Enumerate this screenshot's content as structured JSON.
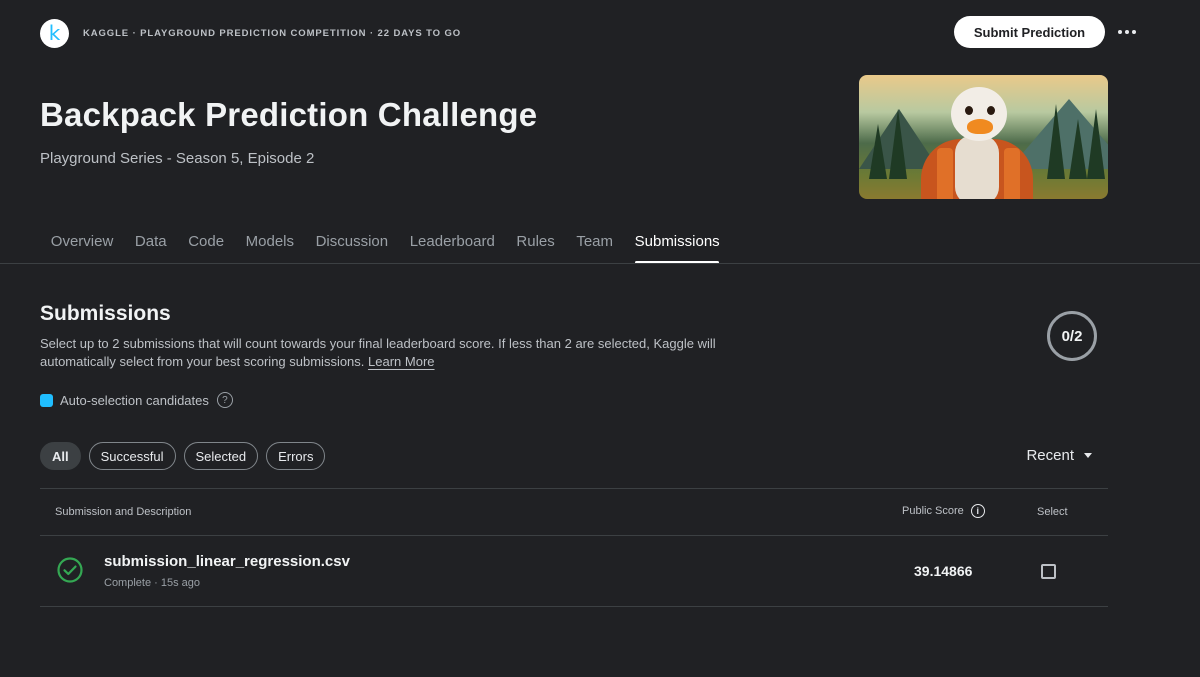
{
  "header": {
    "logo_letter": "k",
    "breadcrumb": "KAGGLE · PLAYGROUND PREDICTION COMPETITION · 22 DAYS TO GO",
    "submit_label": "Submit Prediction",
    "more_icon": "more-horizontal-icon"
  },
  "competition": {
    "title": "Backpack Prediction Challenge",
    "subtitle": "Playground Series - Season 5, Episode 2",
    "hero_image_alt": "Duck wearing a backpack in a mountain forest"
  },
  "tabs": [
    {
      "label": "Overview",
      "active": false
    },
    {
      "label": "Data",
      "active": false
    },
    {
      "label": "Code",
      "active": false
    },
    {
      "label": "Models",
      "active": false
    },
    {
      "label": "Discussion",
      "active": false
    },
    {
      "label": "Leaderboard",
      "active": false
    },
    {
      "label": "Rules",
      "active": false
    },
    {
      "label": "Team",
      "active": false
    },
    {
      "label": "Submissions",
      "active": true
    }
  ],
  "submissions": {
    "title": "Submissions",
    "description": "Select up to 2 submissions that will count towards your final leaderboard score. If less than 2 are selected, Kaggle will automatically select from your best scoring submissions.",
    "learn_more": "Learn More",
    "selected_counter": "0/2",
    "legend_label": "Auto-selection candidates",
    "legend_color": "#20beff",
    "help_icon": "?",
    "filters": [
      {
        "label": "All",
        "active": true
      },
      {
        "label": "Successful",
        "active": false
      },
      {
        "label": "Selected",
        "active": false
      },
      {
        "label": "Errors",
        "active": false
      }
    ],
    "sort_label": "Recent",
    "columns": {
      "description": "Submission and Description",
      "score": "Public Score",
      "score_info_icon": "i",
      "select": "Select"
    },
    "rows": [
      {
        "filename": "submission_linear_regression.csv",
        "meta": "Complete · 15s ago",
        "status": "complete",
        "status_color": "#34a853",
        "public_score": "39.14866",
        "selected": false
      }
    ]
  }
}
